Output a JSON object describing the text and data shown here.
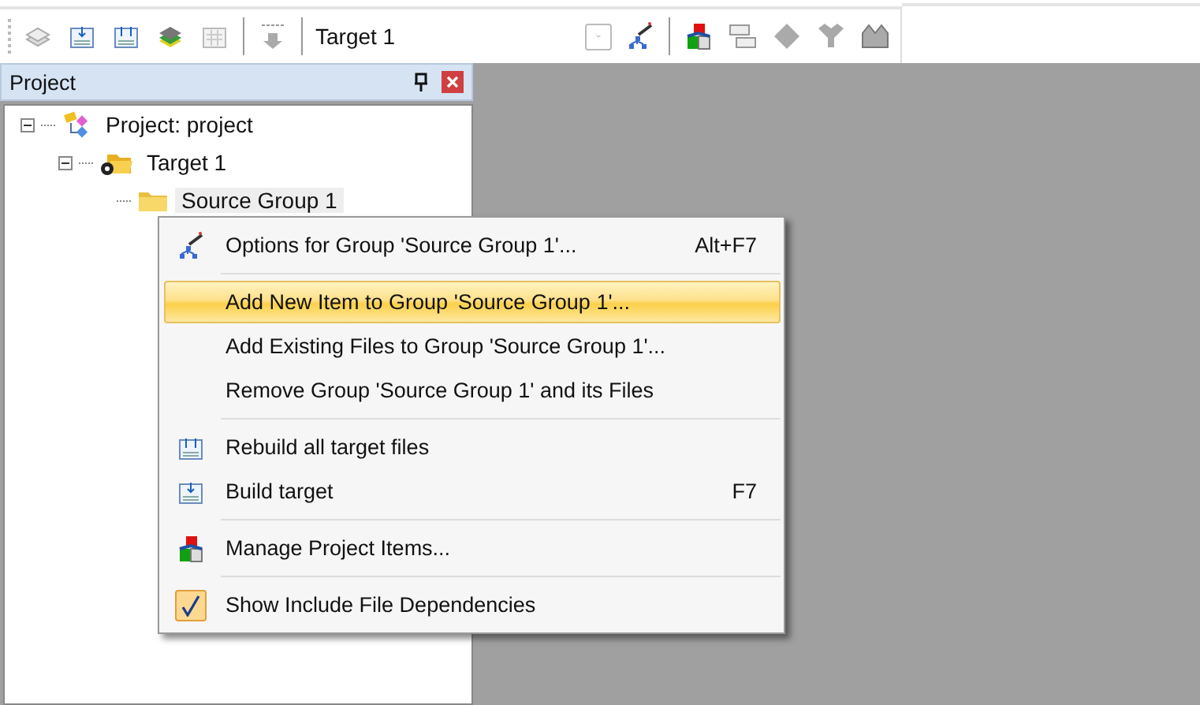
{
  "toolbar": {
    "target": "Target 1"
  },
  "project_panel": {
    "title": "Project",
    "tree": [
      {
        "label": "Project: project",
        "kind": "project",
        "expanded": true,
        "selected": false,
        "children": [
          {
            "label": "Target 1",
            "kind": "target",
            "expanded": true,
            "selected": false,
            "children": [
              {
                "label": "Source Group 1",
                "kind": "group",
                "selected": true
              }
            ]
          }
        ]
      }
    ]
  },
  "context_menu": [
    {
      "kind": "item",
      "label": "Options for Group 'Source Group 1'...",
      "shortcut": "Alt+F7",
      "selected": false
    },
    {
      "kind": "separator"
    },
    {
      "kind": "item",
      "label": "Add New  Item to Group 'Source Group 1'...",
      "selected": true
    },
    {
      "kind": "item",
      "label": "Add Existing Files to Group 'Source Group 1'...",
      "selected": false
    },
    {
      "kind": "item",
      "label": "Remove Group 'Source Group 1' and its Files",
      "selected": false
    },
    {
      "kind": "separator"
    },
    {
      "kind": "item",
      "label": "Rebuild all target files",
      "selected": false
    },
    {
      "kind": "item",
      "label": "Build target",
      "shortcut": "F7",
      "selected": false
    },
    {
      "kind": "separator"
    },
    {
      "kind": "item",
      "label": "Manage Project Items...",
      "selected": false
    },
    {
      "kind": "separator"
    },
    {
      "kind": "check",
      "label": "Show Include File Dependencies",
      "checked": true,
      "selected": false
    }
  ]
}
